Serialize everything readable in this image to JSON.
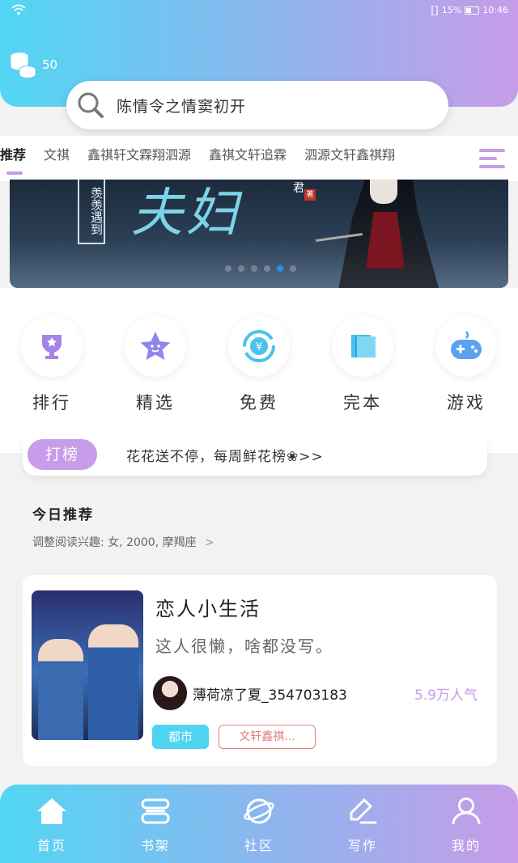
{
  "status_bar": {
    "battery_text": "15%",
    "time": "10:46"
  },
  "header": {
    "coins": "50"
  },
  "search": {
    "placeholder": "陈情令之情窦初开"
  },
  "tabs": [
    "推荐",
    "文祺",
    "鑫祺轩文霖翔泗源",
    "鑫祺文轩追霖",
    "泗源文轩鑫祺翔"
  ],
  "banner": {
    "caption": "羡羡遇到",
    "title": "夫妇",
    "author": "君",
    "seal": "著",
    "slide_count": 6,
    "active_slide": 4
  },
  "quick_links": [
    {
      "label": "排行",
      "icon": "trophy-icon"
    },
    {
      "label": "精选",
      "icon": "star-face-icon"
    },
    {
      "label": "免费",
      "icon": "yuan-coin-icon"
    },
    {
      "label": "完本",
      "icon": "book-icon"
    },
    {
      "label": "游戏",
      "icon": "gamepad-icon"
    }
  ],
  "notice": {
    "badge": "打榜",
    "text": "花花送不停，每周鲜花榜❀>>"
  },
  "section": {
    "title": "今日推荐",
    "subtitle": "调整阅读兴趣: 女, 2000, 摩羯座",
    "chevron": ">"
  },
  "book": {
    "title": "恋人小生活",
    "description": "这人很懒，啥都没写。",
    "author": "薄荷凉了夏_354703183",
    "popularity": "5.9万人气",
    "tags": [
      "都市",
      "文轩鑫祺..."
    ]
  },
  "bottom_nav": [
    {
      "label": "首页",
      "icon": "home-icon"
    },
    {
      "label": "书架",
      "icon": "bookshelf-icon"
    },
    {
      "label": "社区",
      "icon": "planet-icon"
    },
    {
      "label": "写作",
      "icon": "pen-icon"
    },
    {
      "label": "我的",
      "icon": "user-icon"
    }
  ],
  "colors": {
    "gradient_start": "#52d6f3",
    "gradient_end": "#c79ce8",
    "accent_blue": "#2f8ff0",
    "tag_red": "#e37d79"
  }
}
